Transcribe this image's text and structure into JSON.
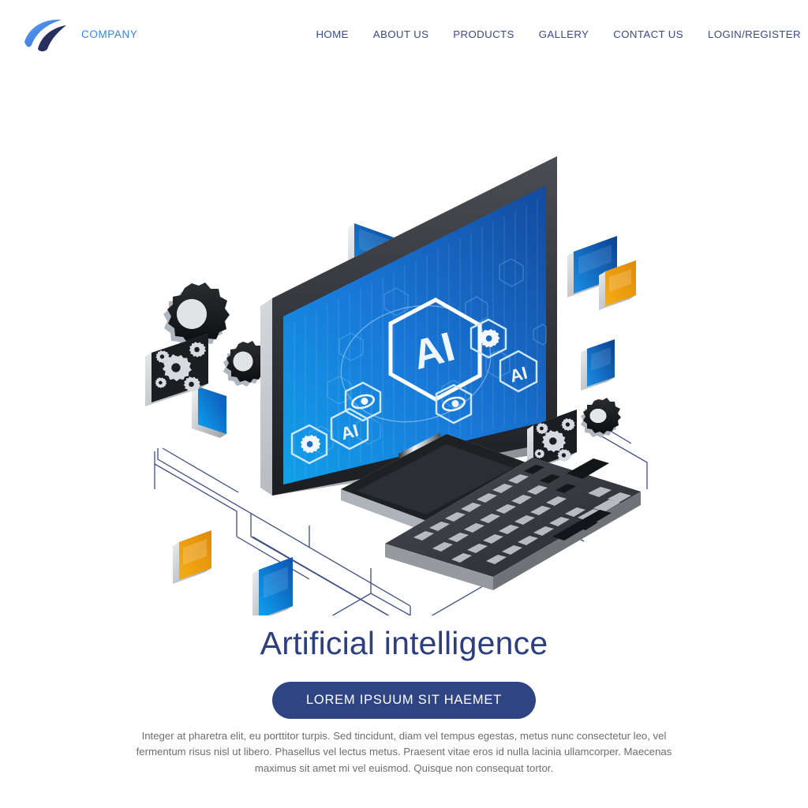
{
  "header": {
    "brand": {
      "name": "COMPANY",
      "logo_icon": "swoosh-wing-logo",
      "color": "#3b82e8"
    },
    "nav": [
      {
        "label": "HOME"
      },
      {
        "label": "ABOUT US"
      },
      {
        "label": "PRODUCTS"
      },
      {
        "label": "GALLERY"
      },
      {
        "label": "CONTACT US"
      },
      {
        "label": "LOGIN/REGISTER"
      }
    ]
  },
  "hero": {
    "illustration": "isometric-desktop-computer-artificial-intelligence",
    "screen": {
      "center_badge": "AI",
      "hex_labels": [
        "AI",
        "AI",
        "AI"
      ],
      "hex_icons": [
        "gear-icon",
        "gear-icon",
        "eye-icon",
        "eye-icon"
      ],
      "screen_gradient_from": "#1a5fc0",
      "screen_gradient_to": "#0e9ae8"
    },
    "floating_cards": [
      {
        "name": "card-blue-top-left",
        "color": "#0f7fd4"
      },
      {
        "name": "card-red-top",
        "color": "#d93113"
      },
      {
        "name": "card-blue-small-left",
        "color": "#0f6fd0"
      },
      {
        "name": "card-blue-top-right",
        "color": "#1058a8"
      },
      {
        "name": "card-orange-top-right",
        "color": "#f0a310"
      },
      {
        "name": "card-blue-right",
        "color": "#0d63c4"
      },
      {
        "name": "card-gears-left",
        "color": "#1b1b1f"
      },
      {
        "name": "card-blue-mid-left",
        "color": "#0f7fd4"
      },
      {
        "name": "card-orange-bottom-left",
        "color": "#f0a310"
      },
      {
        "name": "card-blue-bottom-left",
        "color": "#0f7fd4"
      },
      {
        "name": "card-gears-right",
        "color": "#1b1b1f"
      }
    ],
    "gears": [
      {
        "name": "gear-large-left"
      },
      {
        "name": "gear-small-left"
      },
      {
        "name": "gear-bottom-left"
      },
      {
        "name": "gear-right"
      }
    ],
    "keyboard": {
      "name": "isometric-keyboard",
      "body_color": "#3b3d42",
      "key_color": "#b7b9bd"
    },
    "connector_line_color": "#2b3a7a"
  },
  "content": {
    "headline": "Artificial intelligence",
    "cta_label": "LOREM IPSUUM SIT HAEMET",
    "cta_bg": "#2f4483",
    "paragraph": "Integer at pharetra elit, eu porttitor turpis. Sed tincidunt, diam vel tempus egestas, metus nunc consectetur leo, vel fermentum risus nisl ut libero. Phasellus vel lectus metus. Praesent vitae eros id nulla lacinia ullamcorper. Maecenas maximus sit amet mi vel euismod. Quisque non consequat tortor."
  }
}
